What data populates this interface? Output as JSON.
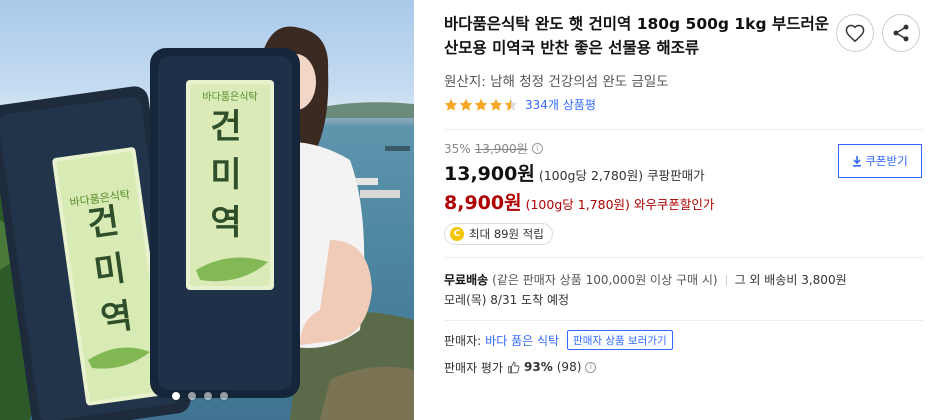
{
  "product": {
    "title": "바다품은식탁 완도 햇 건미역 180g 500g 1kg 부드러운 산모용 미역국 반찬 좋은 선물용 해조류",
    "origin": "원산지: 남해 청정 건강의섬 완도 금일도",
    "rating_stars": 4.5,
    "review_count": "334개 상품평"
  },
  "actions": {
    "wishlist_icon": "heart-icon",
    "share_icon": "share-icon"
  },
  "photo": {
    "package_text_1": "건미역",
    "package_text_2": "건미역",
    "package_brand": "바다품은식탁",
    "slide_count": 4,
    "active_slide": 0
  },
  "price": {
    "discount_rate": "35%",
    "original_price": "13,900원",
    "original_info": "i",
    "sale_price": "13,900원",
    "sale_unit": "(100g당 2,780원)",
    "seller_type": "쿠팡판매가",
    "wow_price": "8,900원",
    "wow_unit": "(100g당 1,780원)",
    "wow_label": "와우쿠폰할인가",
    "coupon_button": "쿠폰받기"
  },
  "points": {
    "coin_label": "C",
    "text": "최대 89원 적립"
  },
  "shipping": {
    "free_label": "무료배송",
    "condition": "(같은 판매자 상품 100,000원 이상 구매 시)",
    "other": "그 외 배송비 3,800원",
    "arrival": "모레(목) 8/31 도착 예정"
  },
  "seller": {
    "label": "판매자:",
    "name": "바다 품은 식탁",
    "view_products_button": "판매자 상품 보러가기",
    "rating_label": "판매자 평가",
    "rating_pct": "93%",
    "rating_count": "(98)",
    "rating_info": "i"
  },
  "colors": {
    "accent_blue": "#346aff",
    "wow_red": "#ae0000",
    "star_yellow": "#f5a623"
  }
}
